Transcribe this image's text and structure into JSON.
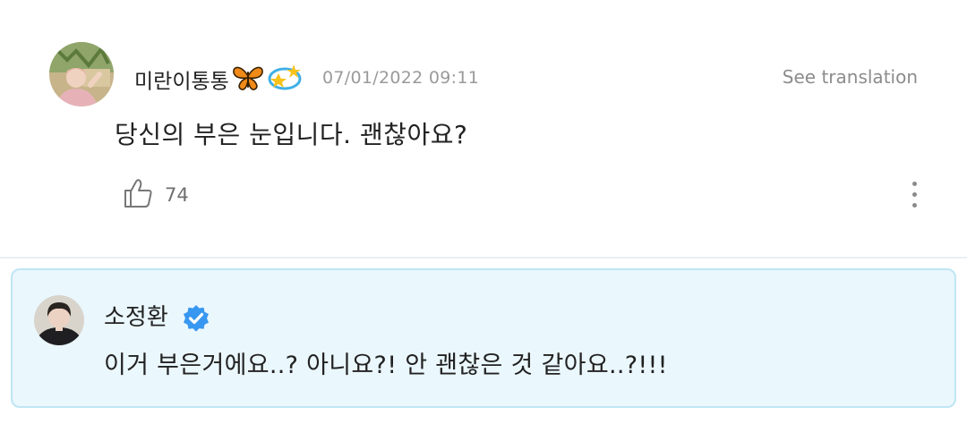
{
  "comment": {
    "author": "미란이통통",
    "author_emoji": [
      "butterfly",
      "dizzy-star"
    ],
    "timestamp": "07/01/2022 09:11",
    "see_translation_label": "See translation",
    "text": "당신의 부은 눈입니다. 괜찮아요?",
    "like_count": "74"
  },
  "reply": {
    "author": "소정환",
    "verified": true,
    "text": "이거 부은거에요..? 아니요?! 안 괜찮은 것 같아요..?!!!"
  },
  "colors": {
    "reply_background": "#eaf7fd",
    "reply_border": "#bfe6f4",
    "verified_badge": "#3897f0",
    "timestamp": "#9a9a9a"
  }
}
